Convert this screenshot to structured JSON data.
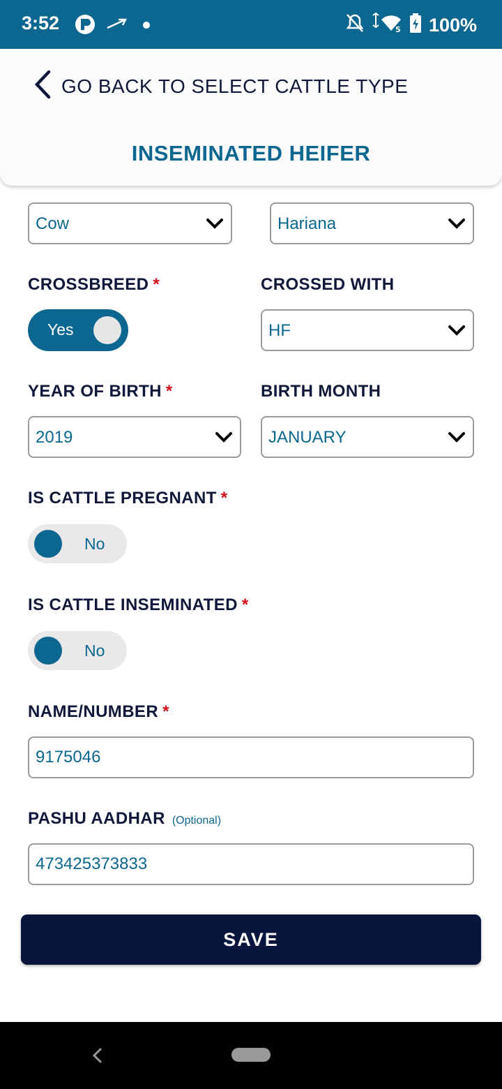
{
  "status_bar": {
    "time": "3:52",
    "battery": "100%"
  },
  "header": {
    "back_label": "GO BACK TO SELECT CATTLE TYPE",
    "title": "INSEMINATED HEIFER"
  },
  "form": {
    "animal_type": {
      "value": "Cow"
    },
    "breed": {
      "value": "Hariana"
    },
    "crossbreed": {
      "label": "CROSSBREED",
      "required": "*",
      "value": "Yes"
    },
    "crossed_with": {
      "label": "CROSSED WITH",
      "value": "HF"
    },
    "year_of_birth": {
      "label": "YEAR OF BIRTH",
      "required": "*",
      "value": "2019"
    },
    "birth_month": {
      "label": "BIRTH MONTH",
      "value": "JANUARY"
    },
    "is_pregnant": {
      "label": "IS CATTLE PREGNANT",
      "required": "*",
      "value": "No"
    },
    "is_inseminated": {
      "label": "IS CATTLE INSEMINATED",
      "required": "*",
      "value": "No"
    },
    "name_number": {
      "label": "NAME/NUMBER",
      "required": "*",
      "value": "9175046"
    },
    "pashu_aadhar": {
      "label": "PASHU AADHAR",
      "optional": "(Optional)",
      "value": "473425373833"
    }
  },
  "save_label": "SAVE",
  "colors": {
    "primary": "#0b6690",
    "dark_navy": "#08163e",
    "required": "#d0101b"
  },
  "icons": [
    "back-chevron-icon",
    "dropdown-chevron-icon",
    "nav-back-icon",
    "wifi-icon",
    "battery-icon",
    "mute-icon"
  ]
}
